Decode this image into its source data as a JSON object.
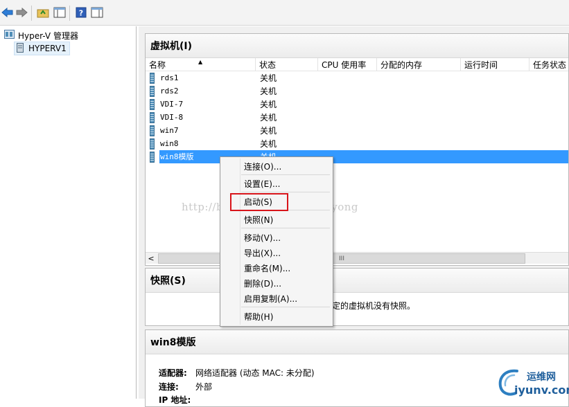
{
  "tree": {
    "root_label": "Hyper-V 管理器",
    "server_label": "HYPERV1"
  },
  "vm_panel": {
    "title": "虚拟机(I)",
    "columns": [
      "名称",
      "状态",
      "CPU 使用率",
      "分配的内存",
      "运行时间",
      "任务状态"
    ],
    "rows": [
      {
        "name": "rds1",
        "state": "关机"
      },
      {
        "name": "rds2",
        "state": "关机"
      },
      {
        "name": "VDI-7",
        "state": "关机"
      },
      {
        "name": "VDI-8",
        "state": "关机"
      },
      {
        "name": "win7",
        "state": "关机"
      },
      {
        "name": "win8",
        "state": "关机"
      },
      {
        "name": "win8模版",
        "state": "关机",
        "selected": true
      }
    ],
    "scroll_glyph": "III",
    "scroll_left_glyph": "<"
  },
  "snapshot_panel": {
    "title": "快照(S)",
    "message": "定的虚拟机没有快照。"
  },
  "details_panel": {
    "title": "win8模版",
    "adapter_label": "适配器:",
    "adapter_value": "网络适配器 (动态 MAC: 未分配)",
    "connection_label": "连接:",
    "connection_value": "外部",
    "ip_label": "IP 地址:"
  },
  "context_menu": {
    "items": [
      {
        "label": "连接(O)..."
      },
      {
        "label": "设置(E)..."
      },
      {
        "label": "启动(S)",
        "highlighted": true
      },
      {
        "label": "快照(N)"
      },
      {
        "label": "移动(V)..."
      },
      {
        "label": "导出(X)..."
      },
      {
        "label": "重命名(M)..."
      },
      {
        "label": "删除(D)..."
      },
      {
        "label": "启用复制(A)..."
      },
      {
        "label": "帮助(H)"
      }
    ]
  },
  "watermark_text": "http://blog.csdn.net/xiezuoyong",
  "logo": {
    "top_text": "运维网",
    "bottom_text": "iyunv.com"
  },
  "colors": {
    "selection": "#3399ff",
    "highlight_box": "#d8141a",
    "accent_blue": "#2d7fc1"
  }
}
